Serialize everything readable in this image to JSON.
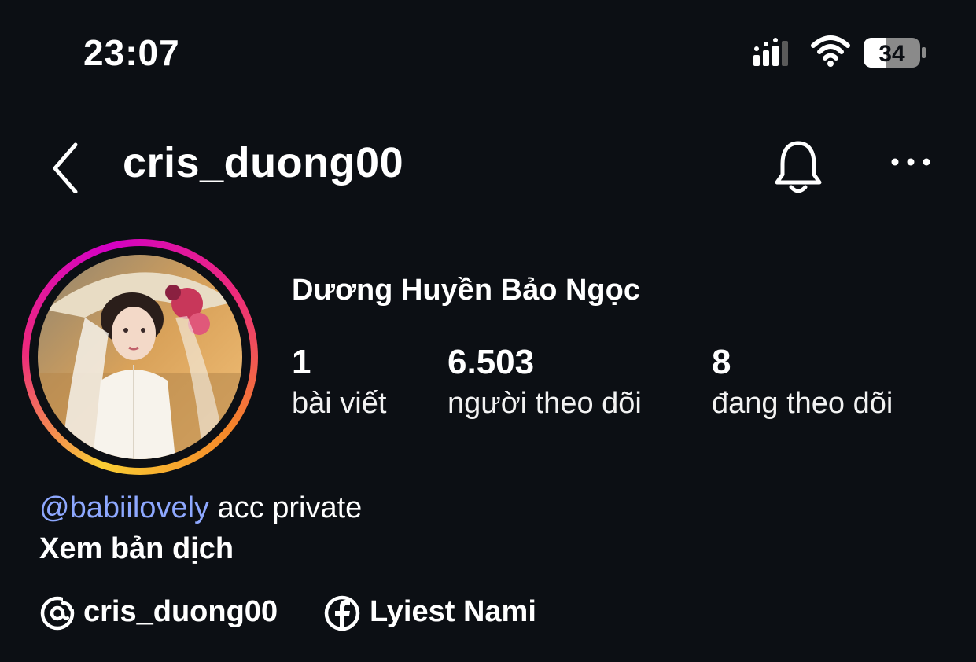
{
  "status": {
    "time": "23:07",
    "battery": "34"
  },
  "header": {
    "username": "cris_duong00"
  },
  "profile": {
    "display_name": "Dương Huyền Bảo Ngọc",
    "stats": [
      {
        "value": "1",
        "label": "bài viết"
      },
      {
        "value": "6.503",
        "label": "người theo dõi"
      },
      {
        "value": "8",
        "label": "đang theo dõi"
      }
    ],
    "bio": {
      "mention": "@babiilovely",
      "text": " acc private"
    },
    "translate_label": "Xem bản dịch",
    "links": [
      {
        "icon": "threads-icon",
        "text": "cris_duong00"
      },
      {
        "icon": "facebook-icon",
        "text": "Lyiest Nami"
      }
    ]
  },
  "colors": {
    "background": "#0c0f14",
    "mention": "#8ea8ff",
    "story_ring": [
      "#f9ce34",
      "#ee2a7b",
      "#d300c5"
    ]
  }
}
